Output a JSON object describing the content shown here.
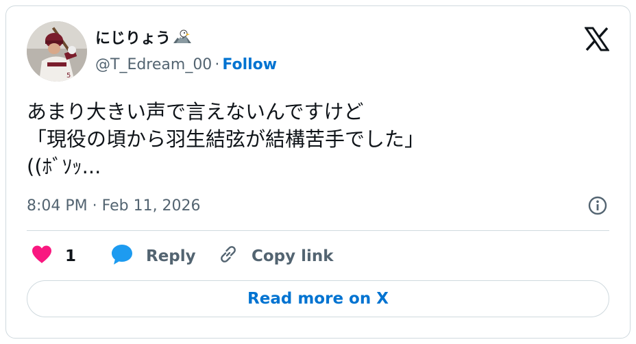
{
  "author": {
    "display_name": "にじりょう",
    "badge_icon": "eagle-emoji-icon",
    "handle": "@T_Edream_00",
    "separator": "·",
    "follow_label": "Follow"
  },
  "brand": {
    "logo_icon": "x-logo-icon"
  },
  "tweet": {
    "lines": [
      "あまり大きい声で言えないんですけど",
      "「現役の頃から羽生結弦が結構苦手でした」",
      "((ﾎﾞｿｯ..."
    ],
    "timestamp": "8:04 PM · Feb 11, 2026"
  },
  "actions": {
    "like_count": "1",
    "reply_label": "Reply",
    "copy_link_label": "Copy link"
  },
  "read_more_label": "Read more on X",
  "colors": {
    "link_blue": "#0073d1",
    "like_pink": "#f91880",
    "reply_blue": "#1d9bf0",
    "muted": "#536471",
    "border": "#cfd9de"
  }
}
